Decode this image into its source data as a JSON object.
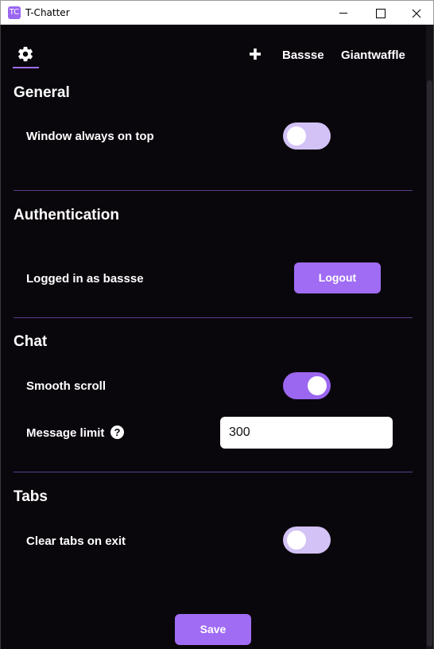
{
  "window": {
    "title": "T-Chatter",
    "icon_text": "TC",
    "accent": "#9b66f0"
  },
  "nav": {
    "settings_icon": "gear-icon",
    "add_icon": "plus-icon",
    "tabs": [
      "Bassse",
      "Giantwaffle"
    ]
  },
  "sections": {
    "general": {
      "title": "General",
      "always_on_top_label": "Window always on top",
      "always_on_top": false
    },
    "authentication": {
      "title": "Authentication",
      "status": "Logged in as bassse",
      "logout_label": "Logout"
    },
    "chat": {
      "title": "Chat",
      "smooth_scroll_label": "Smooth scroll",
      "smooth_scroll": true,
      "message_limit_label": "Message limit",
      "help_icon": "?",
      "message_limit_value": "300"
    },
    "tabs": {
      "title": "Tabs",
      "clear_tabs_label": "Clear tabs on exit",
      "clear_tabs": false
    }
  },
  "footer": {
    "save_label": "Save"
  }
}
